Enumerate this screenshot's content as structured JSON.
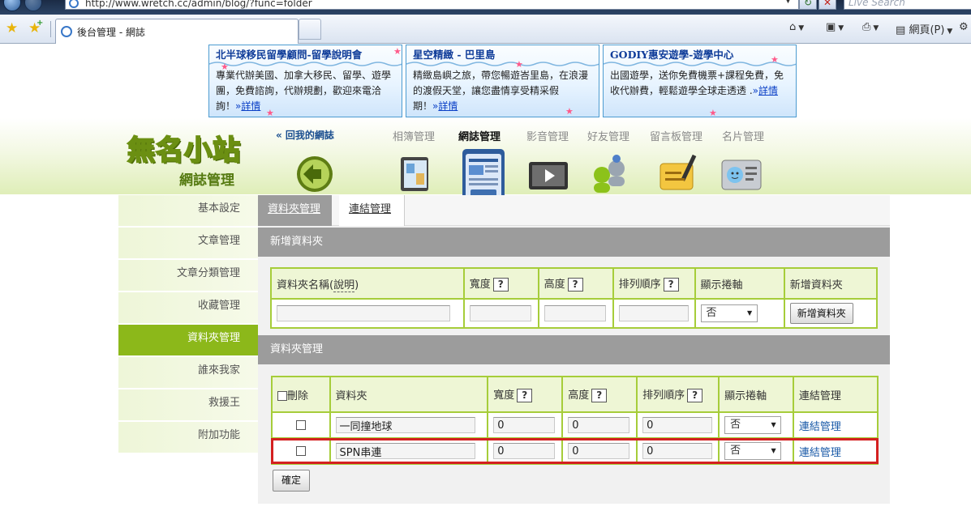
{
  "browser": {
    "url": "http://www.wretch.cc/admin/blog/?func=folder",
    "search_placeholder": "Live Search",
    "tab_title": "後台管理 - 網誌",
    "commands": {
      "page_menu": "網頁(P)"
    }
  },
  "ads": [
    {
      "title": "北半球移民留學顧問-留學說明會",
      "body": "專業代辦美國、加拿大移民、留學、遊學團，免費諮詢，代辦規劃，歡迎來電洽詢！",
      "more": "詳情",
      "arrow": "»"
    },
    {
      "title": "星空精緻 - 巴里島",
      "body": "精緻島嶼之旅，帶您暢遊峇里島，在浪漫的渡假天堂，讓您盡情享受精采假期！",
      "more": "詳情",
      "arrow": "»"
    },
    {
      "title": "GODIY惠安遊學-遊學中心",
      "body": "出國遊學，送你免費機票+課程免費，免收代辦費，輕鬆遊學全球走透透 .",
      "more": "詳情",
      "arrow": "»"
    }
  ],
  "site": {
    "logo": "無名小站",
    "section_title": "網誌管理",
    "back_link": "« 回我的網誌",
    "top_nav": [
      "相簿管理",
      "網誌管理",
      "影音管理",
      "好友管理",
      "留言板管理",
      "名片管理"
    ],
    "top_nav_active": "網誌管理"
  },
  "sidebar": {
    "items": [
      "基本設定",
      "文章管理",
      "文章分類管理",
      "收藏管理",
      "資料夾管理",
      "誰來我家",
      "救援王",
      "附加功能"
    ],
    "active": "資料夾管理"
  },
  "subtabs": {
    "folders": "資料夾管理",
    "links": "連結管理"
  },
  "new_folder": {
    "section_label": "新增資料夾",
    "headers": {
      "name": "資料夾名稱(",
      "name_desc": "說明",
      "name_close": ")",
      "width": "寬度",
      "height": "高度",
      "order": "排列順序",
      "scroll": "顯示捲軸",
      "add": "新增資料夾"
    },
    "help": "?",
    "scroll_value": "否",
    "add_button": "新增資料夾"
  },
  "folder_manage": {
    "section_label": "資料夾管理",
    "headers": {
      "delete": "刪除",
      "folder": "資料夾",
      "width": "寬度",
      "height": "高度",
      "order": "排列順序",
      "scroll": "顯示捲軸",
      "links": "連結管理"
    },
    "help": "?",
    "rows": [
      {
        "name": "一同撞地球",
        "width": "0",
        "height": "0",
        "order": "0",
        "scroll": "否",
        "link": "連結管理"
      },
      {
        "name": "SPN串連",
        "width": "0",
        "height": "0",
        "order": "0",
        "scroll": "否",
        "link": "連結管理"
      }
    ],
    "confirm": "確定"
  },
  "colors": {
    "accent_green": "#8cb81a",
    "table_border": "#a6cd3a",
    "section_gray": "#9c9c9c",
    "highlight": "#d42020"
  }
}
